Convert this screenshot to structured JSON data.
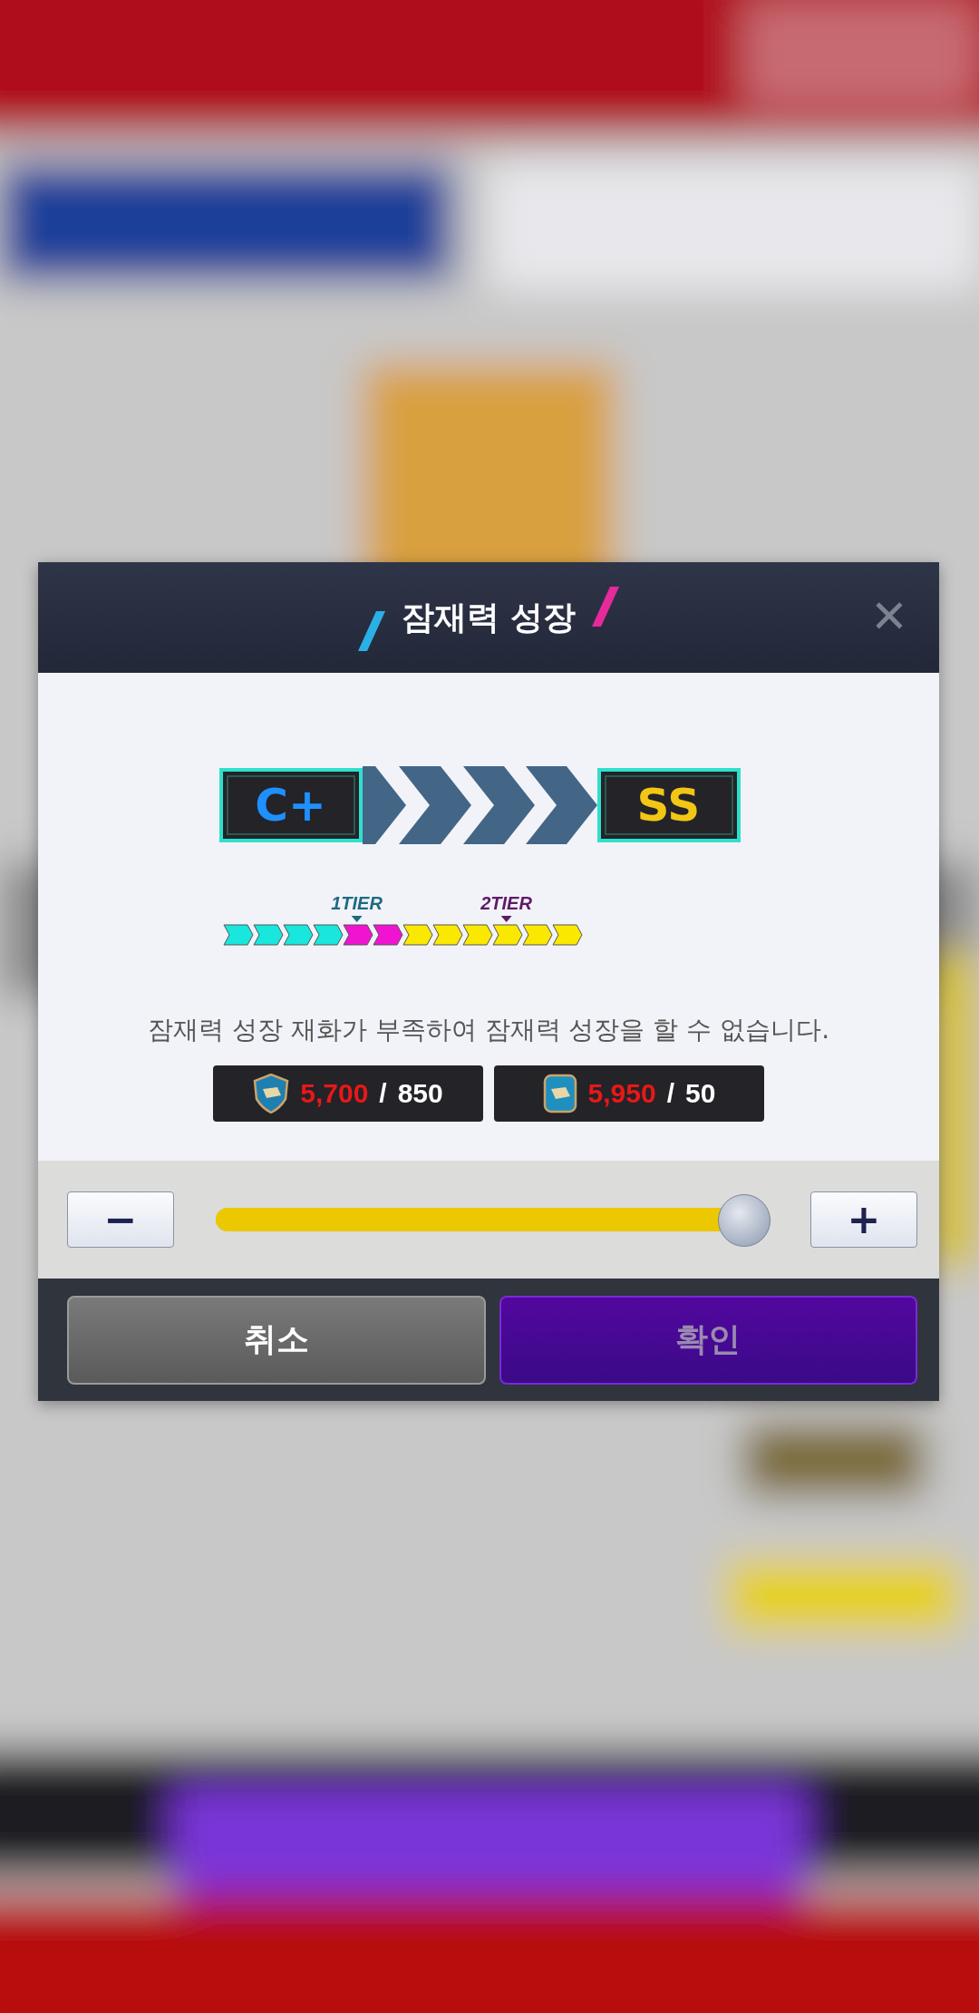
{
  "dialog": {
    "title": "잠재력 성장",
    "close": "✕",
    "grades": [
      {
        "label": "C+",
        "color": "#1e90ff"
      },
      {
        "label": "SS",
        "color": "#f2c615"
      }
    ],
    "segments": [
      {
        "color": "#19e6dc"
      },
      {
        "color": "#19e6dc"
      },
      {
        "color": "#19e6dc"
      },
      {
        "color": "#19e6dc"
      },
      {
        "color": "#f014d2",
        "marker": {
          "label": "1TIER",
          "color": "#1f6a80"
        }
      },
      {
        "color": "#f014d2"
      },
      {
        "color": "#fbe800"
      },
      {
        "color": "#fbe800"
      },
      {
        "color": "#fbe800"
      },
      {
        "color": "#fbe800",
        "marker": {
          "label": "2TIER",
          "color": "#5e1a66"
        }
      },
      {
        "color": "#fbe800"
      },
      {
        "color": "#fbe800"
      }
    ],
    "message": "잠재력 성장 재화가 부족하여 잠재력 성장을 할 수 없습니다.",
    "costs": [
      {
        "kind": "shield",
        "have": "5,700",
        "separator": "/",
        "need": "850"
      },
      {
        "kind": "square",
        "have": "5,950",
        "separator": "/",
        "need": "50"
      }
    ],
    "slider": {
      "minus": "−",
      "plus": "+",
      "level": 1
    },
    "buttons": [
      {
        "label": "취소",
        "kind": "cancel",
        "disabled": false
      },
      {
        "label": "확인",
        "kind": "confirm",
        "disabled": true
      }
    ]
  }
}
